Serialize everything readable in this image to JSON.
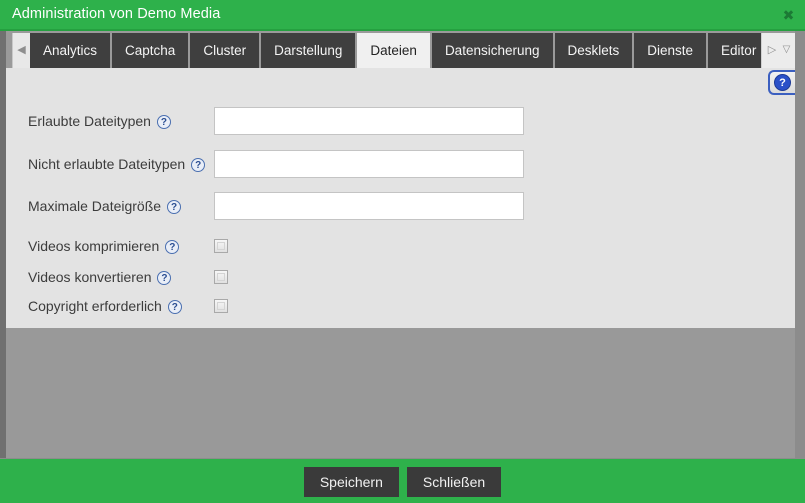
{
  "window": {
    "title": "Administration von Demo Media",
    "close_icon": "✖",
    "title_bg": "#2eb14b"
  },
  "tabbar": {
    "scroll_left_icon": "◀",
    "scroll_right_icon": "▷",
    "dropdown_icon": "▽",
    "active_tab": "Dateien",
    "tabs": [
      {
        "label": "Analytics",
        "active": false
      },
      {
        "label": "Captcha",
        "active": false
      },
      {
        "label": "Cluster",
        "active": false
      },
      {
        "label": "Darstellung",
        "active": false
      },
      {
        "label": "Dateien",
        "active": true
      },
      {
        "label": "Datensicherung",
        "active": false
      },
      {
        "label": "Desklets",
        "active": false
      },
      {
        "label": "Dienste",
        "active": false
      },
      {
        "label": "Editor",
        "active": false
      }
    ]
  },
  "help_tab": {
    "icon": "?"
  },
  "form": {
    "help_icon": "?",
    "text_fields": [
      {
        "label": "Erlaubte Dateitypen",
        "value": "",
        "placeholder": ""
      },
      {
        "label": "Nicht erlaubte Dateitypen",
        "value": "",
        "placeholder": ""
      },
      {
        "label": "Maximale Dateigröße",
        "value": "",
        "placeholder": ""
      }
    ],
    "checkboxes": [
      {
        "label": "Videos komprimieren",
        "checked": false
      },
      {
        "label": "Videos konvertieren",
        "checked": false
      },
      {
        "label": "Copyright erforderlich",
        "checked": false
      }
    ]
  },
  "footer": {
    "save_label": "Speichern",
    "close_label": "Schließen"
  }
}
